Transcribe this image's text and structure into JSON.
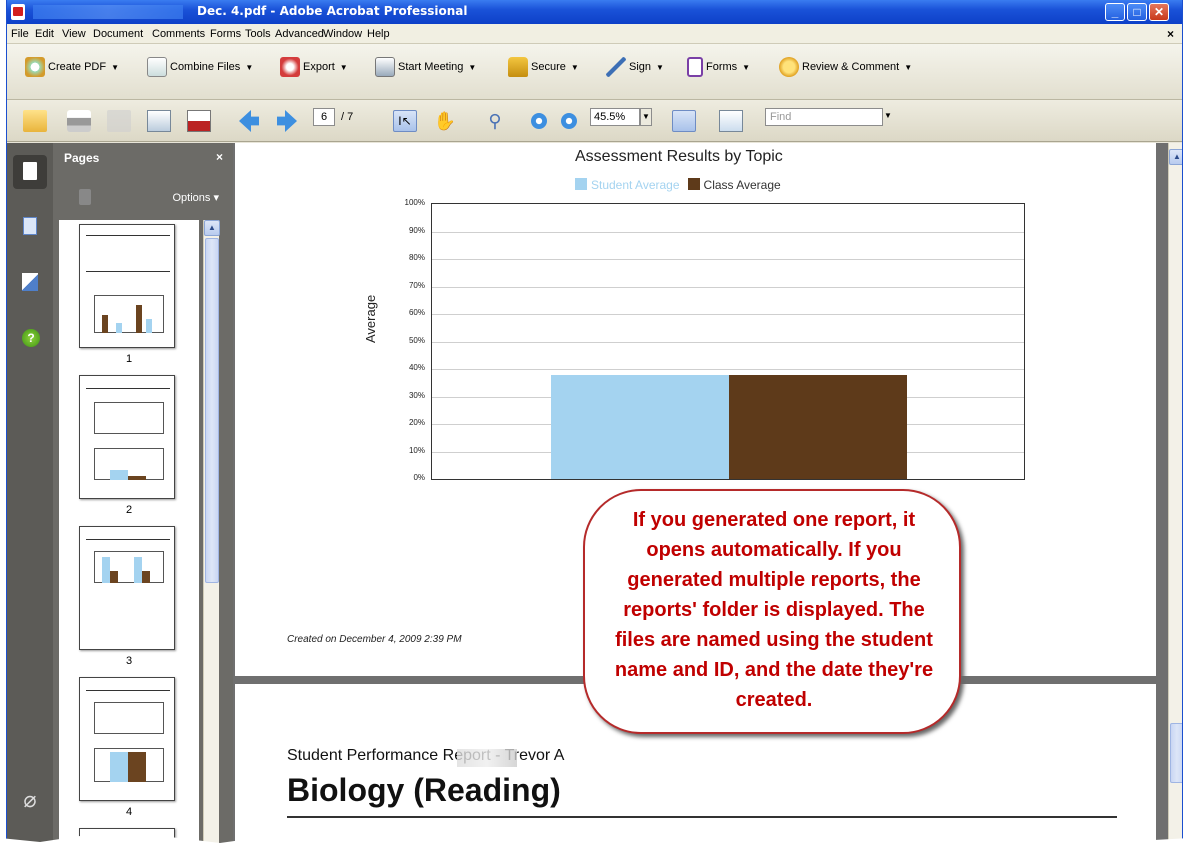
{
  "window": {
    "title": "Dec. 4.pdf - Adobe Acrobat Professional"
  },
  "menu": [
    "File",
    "Edit",
    "View",
    "Document",
    "Comments",
    "Forms",
    "Tools",
    "Advanced",
    "Window",
    "Help"
  ],
  "toolbar1": [
    {
      "label": "Create PDF",
      "icon": "create-pdf-icon"
    },
    {
      "label": "Combine Files",
      "icon": "combine-files-icon"
    },
    {
      "label": "Export",
      "icon": "export-icon"
    },
    {
      "label": "Start Meeting",
      "icon": "meeting-icon"
    },
    {
      "label": "Secure",
      "icon": "lock-icon"
    },
    {
      "label": "Sign",
      "icon": "pen-icon"
    },
    {
      "label": "Forms",
      "icon": "forms-icon"
    },
    {
      "label": "Review & Comment",
      "icon": "comment-icon"
    }
  ],
  "toolbar2": {
    "page_current": "6",
    "page_total": "/ 7",
    "zoom": "45.5%",
    "find_placeholder": "Find"
  },
  "panel": {
    "title": "Pages",
    "close": "×",
    "options": "Options ▾",
    "thumbs": [
      "1",
      "2",
      "3",
      "4"
    ]
  },
  "chart_data": {
    "type": "bar",
    "title": "Assessment Results by Topic",
    "ylabel": "Average",
    "ylim": [
      0,
      100
    ],
    "yticks": [
      "100%",
      "90%",
      "80%",
      "70%",
      "60%",
      "50%",
      "40%",
      "30%",
      "20%",
      "10%",
      "0%"
    ],
    "series": [
      {
        "name": "Student Average",
        "values": [
          38
        ],
        "color": "#a4d3f0"
      },
      {
        "name": "Class Average",
        "values": [
          38
        ],
        "color": "#5e3a1a"
      }
    ],
    "grid": true,
    "legend": "top"
  },
  "page1": {
    "created": "Created on December 4, 2009 2:39 PM"
  },
  "callout": {
    "text": "If you generated one report, it opens automatically. If you generated multiple reports, the reports' folder is displayed. The files are named using the student name and ID, and the date they're created."
  },
  "page2": {
    "subtitle": "Student Performance Report - Trevor A",
    "title": "Biology (Reading)"
  }
}
